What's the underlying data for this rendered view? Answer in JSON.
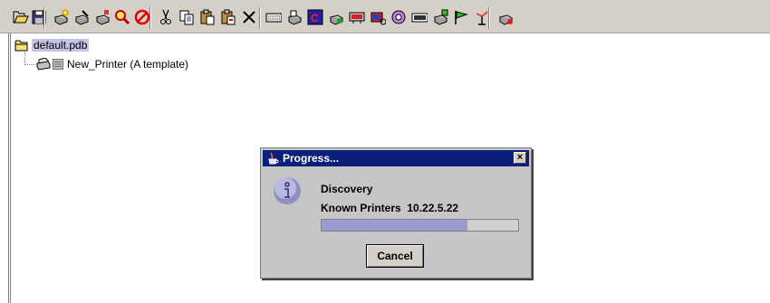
{
  "toolbar": {
    "icons": [
      "open-folder-icon",
      "save-icon",
      "new-printer-icon",
      "edit-printer-icon",
      "printer-properties-icon",
      "discover-icon",
      "stop-icon",
      "cut-icon",
      "copy-icon",
      "paste-icon",
      "paste-special-icon",
      "delete-icon",
      "keyboard-icon",
      "printer-settings-icon",
      "font-icon",
      "add-printer-icon",
      "network-icon",
      "job-icon",
      "plugin-icon",
      "panel-icon",
      "database-icon",
      "flag-icon",
      "antenna-icon",
      "update-icon"
    ]
  },
  "tree": {
    "root_label": "default.pdb",
    "child_label": "New_Printer (A template)"
  },
  "dialog": {
    "title": "Progress...",
    "close_glyph": "×",
    "line1": "Discovery",
    "line2": "Known Printers  10.22.5.22",
    "progress": 0.74,
    "cancel_label": "Cancel"
  }
}
